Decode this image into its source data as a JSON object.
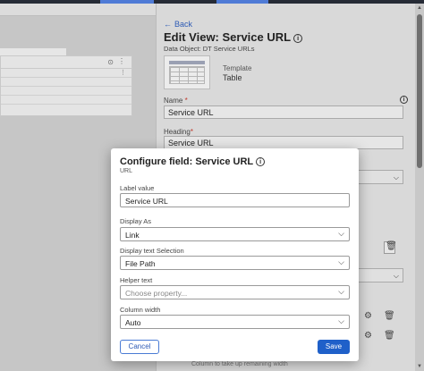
{
  "panel": {
    "back_label": "Back",
    "title": "Edit View: Service URL",
    "subtitle": "Data Object: DT Service URLs",
    "template_label": "Template",
    "template_value": "Table",
    "name_label": "Name",
    "name_value": "Service URL",
    "heading_label": "Heading",
    "heading_value": "Service URL",
    "required_mark": "*",
    "footnote": "Column to take up remaining width"
  },
  "modal": {
    "title": "Configure field: Service URL",
    "subtitle": "URL",
    "label_value_label": "Label value",
    "label_value": "Service URL",
    "display_as_label": "Display As",
    "display_as_value": "Link",
    "display_text_label": "Display text Selection",
    "display_text_value": "File Path",
    "helper_text_label": "Helper text",
    "helper_text_placeholder": "Choose property...",
    "column_width_label": "Column width",
    "column_width_value": "Auto",
    "cancel_label": "Cancel",
    "save_label": "Save"
  },
  "icons": {
    "info": "i",
    "chevron": "⌵",
    "trash": "🗑",
    "gear": "⚙",
    "back_arrow": "←",
    "more": "⋮",
    "search": "⊙"
  },
  "colors": {
    "primary": "#1f60c9",
    "link": "#2e5bb5",
    "required": "#c0392b"
  }
}
